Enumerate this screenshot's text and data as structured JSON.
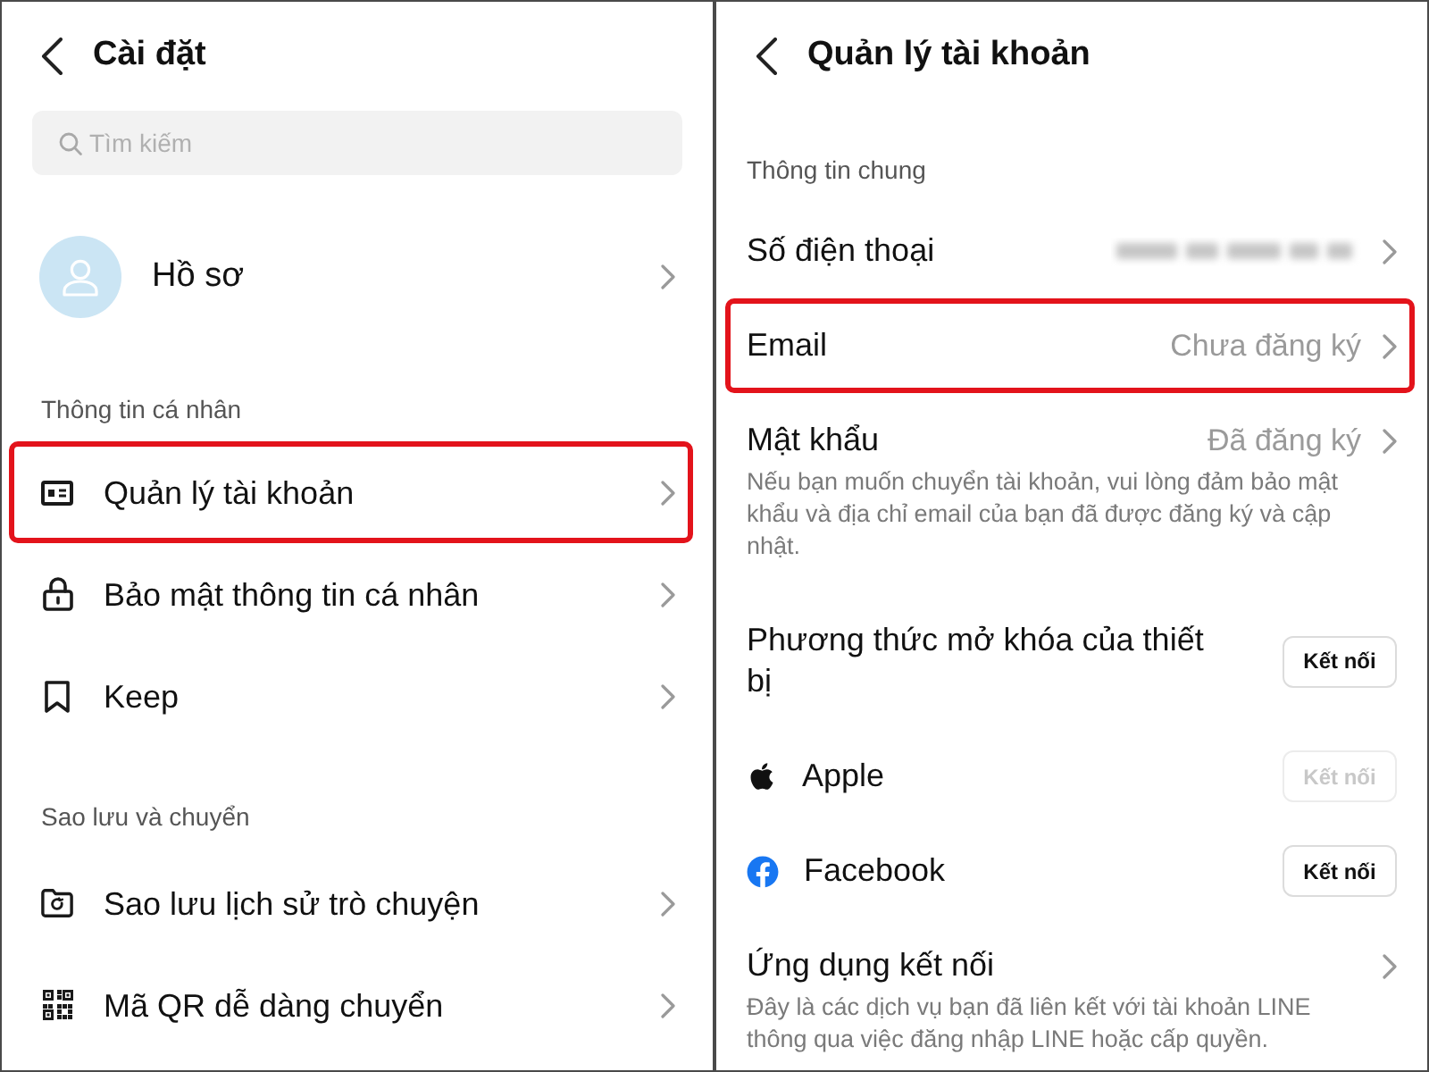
{
  "settings_screen": {
    "title": "Cài đặt",
    "search": {
      "placeholder": "Tìm kiếm"
    },
    "profile": {
      "label": "Hồ sơ"
    },
    "sections": [
      {
        "header": "Thông tin cá nhân",
        "items": [
          {
            "label": "Quản lý tài khoản",
            "highlighted": true
          },
          {
            "label": "Bảo mật thông tin cá nhân",
            "highlighted": false
          },
          {
            "label": "Keep",
            "highlighted": false
          }
        ]
      },
      {
        "header": "Sao lưu và chuyển",
        "items": [
          {
            "label": "Sao lưu lịch sử trò chuyện",
            "highlighted": false
          },
          {
            "label": "Mã QR dễ dàng chuyển",
            "highlighted": false
          }
        ]
      }
    ]
  },
  "account_screen": {
    "title": "Quản lý tài khoản",
    "section_header": "Thông tin chung",
    "items": [
      {
        "kind": "redacted",
        "label": "Số điện thoại",
        "highlighted": false
      },
      {
        "kind": "value",
        "label": "Email",
        "value": "Chưa đăng ký",
        "highlighted": true
      },
      {
        "kind": "value",
        "label": "Mật khẩu",
        "value": "Đã đăng ký",
        "highlighted": false,
        "description": "Nếu bạn muốn chuyển tài khoản, vui lòng đảm bảo mật khẩu và địa chỉ email của bạn đã được đăng ký và cập nhật."
      },
      {
        "kind": "button",
        "label": "Phương thức mở khóa của thiết bị",
        "button": {
          "label": "Kết nối",
          "disabled": false
        },
        "highlighted": false
      },
      {
        "kind": "button",
        "label": "Apple",
        "button": {
          "label": "Kết nối",
          "disabled": true
        },
        "highlighted": false
      },
      {
        "kind": "button",
        "label": "Facebook",
        "button": {
          "label": "Kết nối",
          "disabled": false
        },
        "highlighted": false
      },
      {
        "kind": "link",
        "label": "Ứng dụng kết nối",
        "highlighted": false,
        "description": "Đây là các dịch vụ bạn đã liên kết với tài khoản LINE thông qua việc đăng nhập LINE hoặc cấp quyền."
      }
    ]
  }
}
